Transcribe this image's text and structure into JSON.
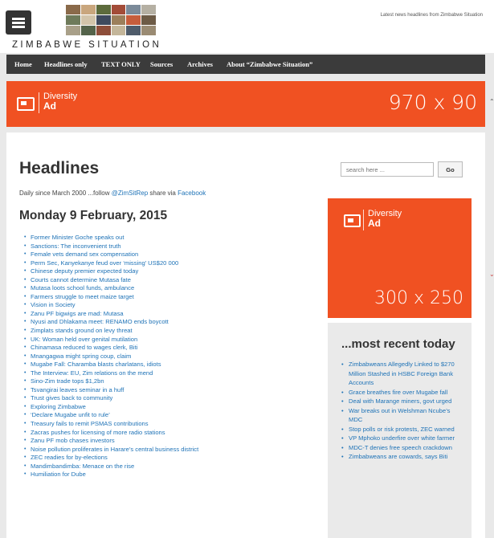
{
  "header": {
    "site_title": "ZIMBABWE SITUATION",
    "tagline": "Latest news headlines from Zimbabwe Situation"
  },
  "nav": {
    "items": [
      "Home",
      "Headlines only",
      "TEXT ONLY",
      "Sources",
      "Archives",
      "About “Zimbabwe Situation”"
    ]
  },
  "ads": {
    "leaderboard": {
      "brand_top": "Diversity",
      "brand_bottom": "Ad",
      "size": "970 x 90"
    },
    "sidebar": {
      "brand_top": "Diversity",
      "brand_bottom": "Ad",
      "size": "300 x 250"
    }
  },
  "main": {
    "title": "Headlines",
    "intro_prefix": "Daily since March 2000 ...follow ",
    "intro_twitter": "@ZimSitRep",
    "intro_mid": " share via ",
    "intro_facebook": "Facebook",
    "date_heading": "Monday 9 February, 2015",
    "headlines": [
      "Former Minister Goche speaks out",
      "Sanctions: The inconvenient truth",
      "Female vets demand sex compensation",
      "Perm Sec, Kanyekanye feud over ‘missing’ US$20 000",
      "Chinese deputy premier expected today",
      "Courts cannot determine Mutasa fate",
      "Mutasa loots school funds, ambulance",
      "Farmers struggle to meet maize target",
      "Vision in Society",
      "Zanu PF bigwigs are mad: Mutasa",
      "Nyusi and Dhlakama meet: RENAMO ends boycott",
      "Zimplats stands ground on levy threat",
      "UK: Woman held over genital mutilation",
      "Chinamasa reduced to wages clerk, Biti",
      "Mnangagwa might spring coup, claim",
      "Mugabe Fall: Charamba blasts charlatans, idiots",
      "The Interview: EU, Zim relations on the mend",
      "Sino-Zim trade tops $1,2bn",
      "Tsvangirai leaves seminar in a huff",
      "Trust gives back to community",
      "Exploring Zimbabwe",
      "‘Declare Mugabe unfit to rule’",
      "Treasury fails to remit PSMAS contributions",
      "Zacras pushes for licensing of more radio stations",
      "Zanu PF mob chases investors",
      "Noise pollution proliferates in Harare’s central business district",
      "ZEC readies for by-elections",
      "Mandimbandimba: Menace on the rise",
      "Humiliation for Dube"
    ]
  },
  "sidebar": {
    "search_placeholder": "search here ...",
    "search_button": "Go",
    "recent_title": "...most recent today",
    "recent": [
      "Zimbabweans Allegedly Linked to $270 Million Stashed in HSBC Foreign Bank Accounts",
      "Grace breathes fire over Mugabe fall",
      "Deal with Marange miners, govt urged",
      "War breaks out in Welshman Ncube’s MDC",
      "Stop polls or risk protests, ZEC warned",
      "VP Mphoko underfire over white farmer",
      "MDC-T denies free speech crackdown",
      "Zimbabweans are cowards, says Biti"
    ]
  },
  "colors": {
    "accent": "#f05122",
    "link": "#1f73b7",
    "nav_bg": "#3b3b3b"
  }
}
